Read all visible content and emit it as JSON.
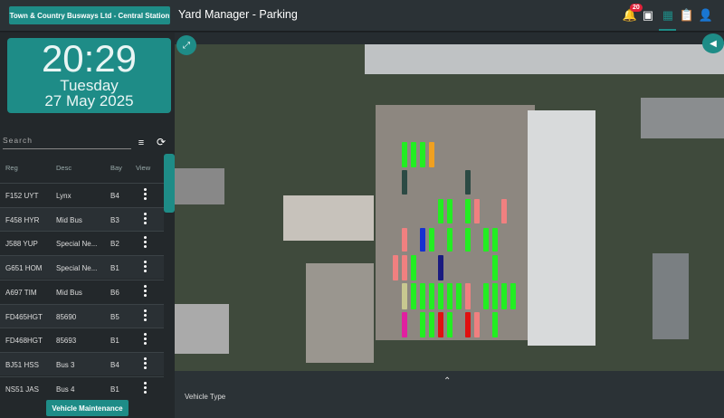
{
  "header": {
    "station": "Town & Country Busways Ltd - Central Station",
    "title": "Yard Manager - Parking",
    "notification_count": "20",
    "icons": [
      "bell-icon",
      "home-user-icon",
      "hierarchy-icon",
      "clipboard-edit-icon",
      "user-icon"
    ],
    "accent": "#1e8c87"
  },
  "clock": {
    "time": "20:29",
    "day": "Tuesday",
    "date": "27 May 2025"
  },
  "search": {
    "placeholder": "Search"
  },
  "table": {
    "columns": [
      "Reg",
      "Desc",
      "Bay",
      "View"
    ],
    "rows": [
      {
        "reg": "F152 UYT",
        "desc": "Lynx",
        "bay": "B4"
      },
      {
        "reg": "F458 HYR",
        "desc": "Mid Bus",
        "bay": "B3"
      },
      {
        "reg": "J588 YUP",
        "desc": "Special Ne...",
        "bay": "B2"
      },
      {
        "reg": "G651 HOM",
        "desc": "Special Ne...",
        "bay": "B1"
      },
      {
        "reg": "A697 TIM",
        "desc": "Mid Bus",
        "bay": "B6"
      },
      {
        "reg": "FD465HGT",
        "desc": "85690",
        "bay": "B5"
      },
      {
        "reg": "FD468HGT",
        "desc": "85693",
        "bay": "B1"
      },
      {
        "reg": "BJ51 HSS",
        "desc": "Bus 3",
        "bay": "B4"
      },
      {
        "reg": "NS51 JAS",
        "desc": "Bus 4",
        "bay": "B1"
      }
    ]
  },
  "footer": {
    "maintenance_button": "Vehicle Maintenance"
  },
  "panel": {
    "vehicle_type_label": "Vehicle Type"
  },
  "bus_colors": {
    "green": "#22ee22",
    "orange": "#f0a020",
    "dark": "#2c4a44",
    "pink": "#f08080",
    "blue": "#1530d0",
    "navy": "#1a1a80",
    "khaki": "#c8c890",
    "magenta": "#e020a0",
    "red": "#e01010"
  },
  "parked_buses": [
    [
      [
        0,
        "green"
      ],
      [
        1,
        "green"
      ],
      [
        2,
        "green"
      ],
      [
        3,
        "orange"
      ]
    ],
    [
      [
        0,
        "dark"
      ],
      [
        7,
        "dark"
      ]
    ],
    [
      [
        4,
        "green"
      ],
      [
        5,
        "green"
      ],
      [
        7,
        "green"
      ],
      [
        8,
        "pink"
      ],
      [
        11,
        "pink"
      ]
    ],
    [
      [
        0,
        "pink"
      ],
      [
        2,
        "blue"
      ],
      [
        3,
        "green"
      ],
      [
        5,
        "green"
      ],
      [
        7,
        "green"
      ],
      [
        9,
        "green"
      ],
      [
        10,
        "green"
      ]
    ],
    [
      [
        -1,
        "pink"
      ],
      [
        0,
        "pink"
      ],
      [
        1,
        "green"
      ],
      [
        4,
        "navy"
      ],
      [
        10,
        "green"
      ]
    ],
    [
      [
        0,
        "khaki"
      ],
      [
        1,
        "green"
      ],
      [
        2,
        "green"
      ],
      [
        3,
        "green"
      ],
      [
        4,
        "green"
      ],
      [
        5,
        "green"
      ],
      [
        6,
        "green"
      ],
      [
        7,
        "pink"
      ],
      [
        9,
        "green"
      ],
      [
        10,
        "green"
      ],
      [
        11,
        "green"
      ],
      [
        12,
        "green"
      ]
    ],
    [
      [
        0,
        "magenta"
      ],
      [
        2,
        "green"
      ],
      [
        3,
        "green"
      ],
      [
        4,
        "red"
      ],
      [
        5,
        "green"
      ],
      [
        7,
        "red"
      ],
      [
        8,
        "pink"
      ],
      [
        10,
        "green"
      ]
    ]
  ]
}
